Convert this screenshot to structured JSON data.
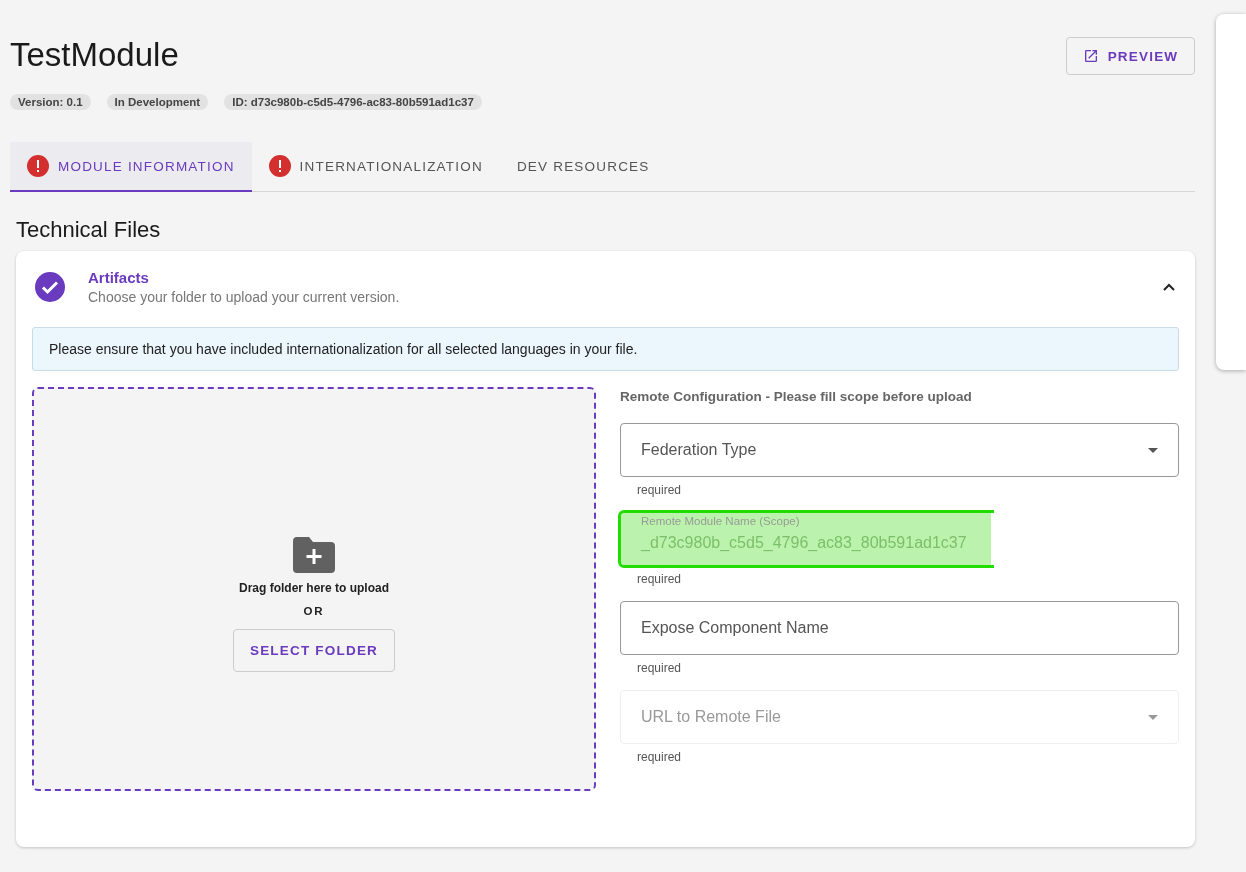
{
  "header": {
    "title": "TestModule",
    "chips": [
      "Version: 0.1",
      "In Development",
      "ID: d73c980b-c5d5-4796-ac83-80b591ad1c37"
    ],
    "preview_button": "PREVIEW"
  },
  "tabs": [
    {
      "label": "MODULE INFORMATION",
      "selected": true,
      "error": true
    },
    {
      "label": "INTERNATIONALIZATION",
      "selected": false,
      "error": true
    },
    {
      "label": "DEV RESOURCES",
      "selected": false,
      "error": false
    }
  ],
  "section_title": "Technical Files",
  "panel": {
    "title": "Artifacts",
    "subtitle": "Choose your folder to upload your current version.",
    "completed": true,
    "expanded": true,
    "alert": "Please ensure that you have included internationalization for all selected languages in your file.",
    "dropzone": {
      "text": "Drag folder here to upload",
      "or": "OR",
      "button": "SELECT FOLDER"
    },
    "config_title": "Remote Configuration - Please fill scope before upload",
    "fields": [
      {
        "kind": "select",
        "label": "Federation Type",
        "hint": "required",
        "disabled": false,
        "highlighted": false
      },
      {
        "kind": "text",
        "label": "Remote Module Name (Scope)",
        "value": "_d73c980b_c5d5_4796_ac83_80b591ad1c37",
        "hint": "required",
        "disabled": true,
        "highlighted": true
      },
      {
        "kind": "text",
        "label": "Expose Component Name",
        "hint": "required",
        "disabled": false,
        "highlighted": false
      },
      {
        "kind": "select",
        "label": "URL to Remote File",
        "hint": "required",
        "disabled": true,
        "highlighted": false
      }
    ]
  }
}
